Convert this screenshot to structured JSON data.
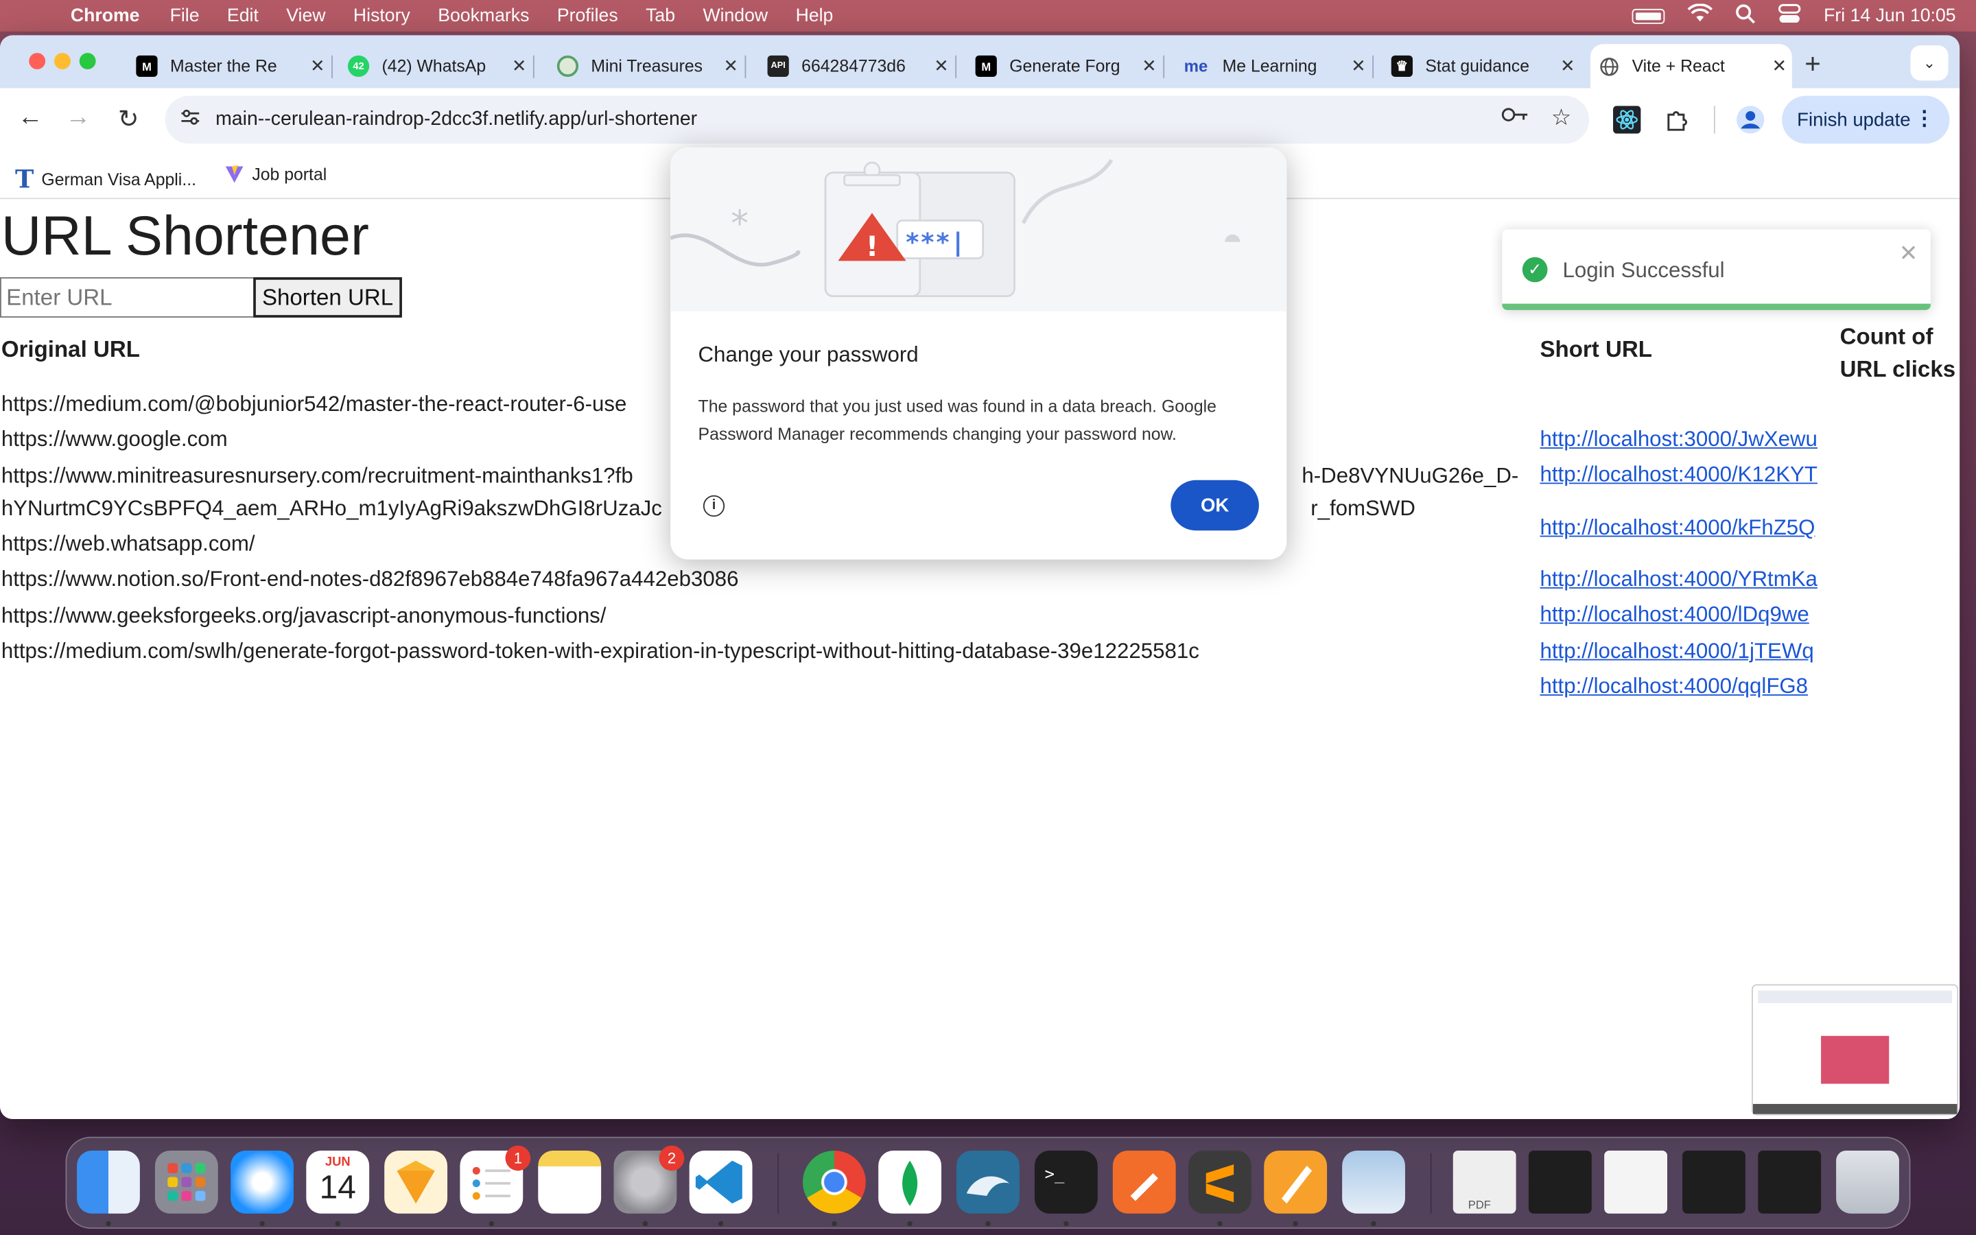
{
  "menubar": {
    "app": "Chrome",
    "items": [
      "File",
      "Edit",
      "View",
      "History",
      "Bookmarks",
      "Profiles",
      "Tab",
      "Window",
      "Help"
    ],
    "datetime": "Fri 14 Jun  10:05"
  },
  "tabs": [
    {
      "label": "Master the Re",
      "fav_color": "#000000",
      "fav_text": "M"
    },
    {
      "label": "(42) WhatsAp",
      "fav_color": "#25d366",
      "fav_text": "42"
    },
    {
      "label": "Mini Treasures",
      "fav_color": "#5aa06a",
      "fav_text": ""
    },
    {
      "label": "664284773d6",
      "fav_color": "#222222",
      "fav_text": "API"
    },
    {
      "label": "Generate Forg",
      "fav_color": "#000000",
      "fav_text": "M"
    },
    {
      "label": "Me Learning",
      "fav_color": "#ffffff",
      "fav_text": "me"
    },
    {
      "label": "Stat guidance",
      "fav_color": "#111111",
      "fav_text": "♛"
    },
    {
      "label": "Vite + React",
      "fav_color": "#ffffff",
      "fav_text": "🌐"
    }
  ],
  "address": {
    "host": "main--cerulean-raindrop-2dcc3f.netlify.app",
    "path": "/url-shortener"
  },
  "finish_update": "Finish update",
  "bookmarks": [
    "German Visa Appli...",
    "Job portal"
  ],
  "page": {
    "title": "URL Shortener",
    "input_placeholder": "Enter URL",
    "button": "Shorten URL",
    "col_original": "Original URL",
    "col_short": "Short URL",
    "col_count_1": "Count of",
    "col_count_2": "URL clicks",
    "original_lines": [
      "https://medium.com/@bobjunior542/master-the-react-router-6-use",
      "https://www.google.com",
      "https://www.minitreasuresnursery.com/recruitment-mainthanks1?fb",
      "hYNurtmC9YCsBPFQ4_aem_ARHo_m1yIyAgRi9akszwDhGI8rUzaJc",
      "https://web.whatsapp.com/",
      "https://www.notion.so/Front-end-notes-d82f8967eb884e748fa967a442eb3086",
      "https://www.geeksforgeeks.org/javascript-anonymous-functions/",
      "https://medium.com/swlh/generate-forgot-password-token-with-expiration-in-typescript-without-hitting-database-39e12225581c"
    ],
    "right_fragment_1": "h-De8VYNUuG26e_D-",
    "right_fragment_2": "r_fomSWD",
    "short_urls": [
      "http://localhost:3000/JwXewu",
      "http://localhost:4000/K12KYT",
      "http://localhost:4000/kFhZ5Q",
      "http://localhost:4000/YRtmKa",
      "http://localhost:4000/lDq9we",
      "http://localhost:4000/1jTEWq",
      "http://localhost:4000/qqlFG8"
    ]
  },
  "toast": {
    "message": "Login Successful"
  },
  "dialog": {
    "title": "Change your password",
    "body": "The password that you just used was found in a data breach. Google Password Manager recommends changing your password now.",
    "ok": "OK",
    "masked": "***|"
  },
  "dock": {
    "calendar_month": "JUN",
    "calendar_day": "14",
    "badge_reminders": "1",
    "badge_settings": "2"
  }
}
